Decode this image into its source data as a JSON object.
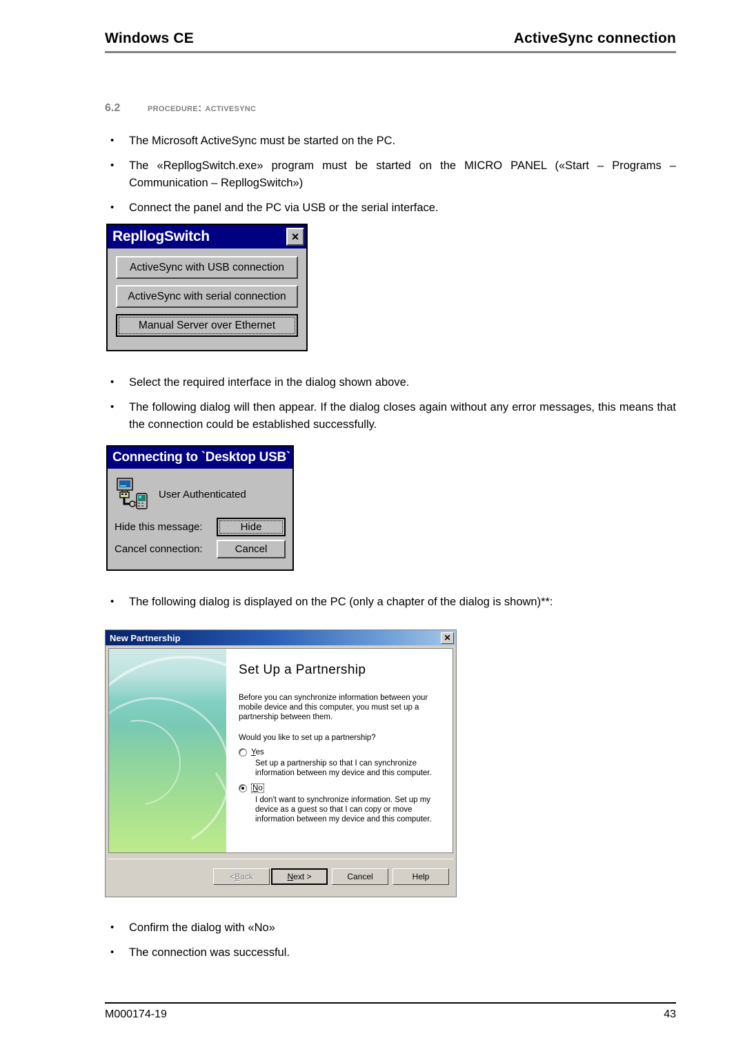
{
  "header": {
    "left": "Windows CE",
    "right": "ActiveSync connection"
  },
  "section": {
    "number": "6.2",
    "title": "Procedure: ActiveSync"
  },
  "bullets_group_1": [
    "The Microsoft ActiveSync must be started on the PC.",
    "The «RepllogSwitch.exe» program must be started on the MICRO PANEL («Start – Programs – Communication – RepllogSwitch»)",
    "Connect the panel and the PC via USB or the serial interface."
  ],
  "bullets_group_2": [
    "Select the required interface in the dialog shown above.",
    "The following dialog will then appear. If the dialog closes again without any error messages, this means that the connection could be established successfully."
  ],
  "bullets_group_3": [
    "The following dialog is displayed on the PC (only a chapter of the dialog is shown)**:"
  ],
  "bullets_group_4": [
    "Confirm the dialog with «No»",
    "The connection was successful."
  ],
  "repllog_dialog": {
    "title": "RepllogSwitch",
    "close_label": "×",
    "buttons": [
      {
        "label": "ActiveSync with USB connection",
        "focused": false
      },
      {
        "label": "ActiveSync with serial connection",
        "focused": false
      },
      {
        "label": "Manual Server over Ethernet",
        "focused": true
      }
    ]
  },
  "connecting_dialog": {
    "title": "Connecting to `Desktop USB`",
    "status": "User Authenticated",
    "rows": [
      {
        "label": "Hide this message:",
        "button": "Hide",
        "focused": true
      },
      {
        "label": "Cancel connection:",
        "button": "Cancel",
        "focused": false
      }
    ]
  },
  "partnership_dialog": {
    "title": "New Partnership",
    "close_label": "✕",
    "heading": "Set Up a Partnership",
    "intro": "Before you can synchronize information between your mobile device and this computer, you must set up a partnership between them.",
    "question": "Would you like to set up a partnership?",
    "options": [
      {
        "label": "Yes",
        "mnemonic": "Y",
        "rest": "es",
        "checked": false,
        "focused": false,
        "description": "Set up a partnership so that I can synchronize information between my device and this computer."
      },
      {
        "label": "No",
        "mnemonic": "N",
        "rest": "o",
        "checked": true,
        "focused": true,
        "description": "I don't want to synchronize information. Set up my device as a guest so that I can copy or move information between my device and this computer."
      }
    ],
    "buttons": [
      {
        "label": "< Back",
        "state": "disabled",
        "pre": "< ",
        "mnemonic": "B",
        "post": "ack"
      },
      {
        "label": "Next >",
        "state": "default",
        "pre": "",
        "mnemonic": "N",
        "post": "ext >"
      },
      {
        "label": "Cancel",
        "state": "normal",
        "pre": "Cancel",
        "mnemonic": "",
        "post": ""
      },
      {
        "label": "Help",
        "state": "normal",
        "pre": "Help",
        "mnemonic": "",
        "post": ""
      }
    ]
  },
  "footer": {
    "document_id": "M000174-19",
    "page_number": "43"
  }
}
